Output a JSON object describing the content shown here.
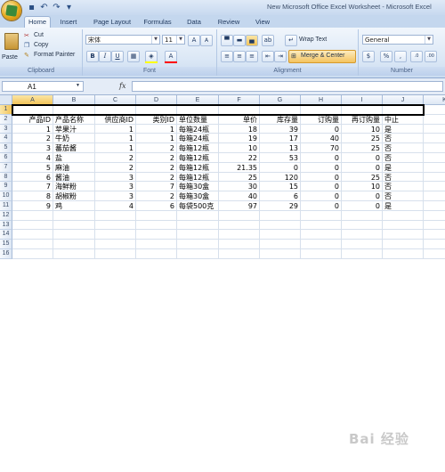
{
  "window": {
    "title": "New Microsoft Office Excel Worksheet - Microsoft Excel"
  },
  "tabs": [
    "Home",
    "Insert",
    "Page Layout",
    "Formulas",
    "Data",
    "Review",
    "View"
  ],
  "ribbon": {
    "clipboard": {
      "paste": "Paste",
      "cut": "Cut",
      "copy": "Copy",
      "format_painter": "Format Painter",
      "label": "Clipboard"
    },
    "font": {
      "name": "宋体",
      "size": "11",
      "bold": "B",
      "italic": "I",
      "underline": "U",
      "label": "Font",
      "font_color": "#ff0000",
      "fill_color": "#ffff00"
    },
    "alignment": {
      "wrap": "Wrap Text",
      "merge": "Merge & Center",
      "label": "Alignment"
    },
    "number": {
      "format": "General",
      "currency": "$",
      "percent": "%",
      "comma": ",",
      "label": "Number"
    }
  },
  "formula_bar": {
    "name_box": "A1",
    "fx": "fx",
    "value": ""
  },
  "columns": [
    "A",
    "B",
    "C",
    "D",
    "E",
    "F",
    "G",
    "H",
    "I",
    "J",
    "K"
  ],
  "row_numbers": [
    "1",
    "2",
    "3",
    "4",
    "5",
    "6",
    "7",
    "8",
    "9",
    "10",
    "11",
    "12",
    "13",
    "14",
    "15",
    "16"
  ],
  "headers": [
    "产品ID",
    "产品名称",
    "供应商ID",
    "类别ID",
    "单位数量",
    "单价",
    "库存量",
    "订购量",
    "再订购量",
    "中止"
  ],
  "rows": [
    [
      "1",
      "苹果汁",
      "1",
      "1",
      "每箱24瓶",
      "18",
      "39",
      "0",
      "10",
      "是"
    ],
    [
      "2",
      "牛奶",
      "1",
      "1",
      "每箱24瓶",
      "19",
      "17",
      "40",
      "25",
      "否"
    ],
    [
      "3",
      "蕃茄酱",
      "1",
      "2",
      "每箱12瓶",
      "10",
      "13",
      "70",
      "25",
      "否"
    ],
    [
      "4",
      "盐",
      "2",
      "2",
      "每箱12瓶",
      "22",
      "53",
      "0",
      "0",
      "否"
    ],
    [
      "5",
      "麻油",
      "2",
      "2",
      "每箱12瓶",
      "21.35",
      "0",
      "0",
      "0",
      "是"
    ],
    [
      "6",
      "酱油",
      "3",
      "2",
      "每箱12瓶",
      "25",
      "120",
      "0",
      "25",
      "否"
    ],
    [
      "7",
      "海鲜粉",
      "3",
      "7",
      "每箱30盒",
      "30",
      "15",
      "0",
      "10",
      "否"
    ],
    [
      "8",
      "胡椒粉",
      "3",
      "2",
      "每箱30盒",
      "40",
      "6",
      "0",
      "0",
      "否"
    ],
    [
      "9",
      "鸡",
      "4",
      "6",
      "每袋500克",
      "97",
      "29",
      "0",
      "0",
      "是"
    ]
  ],
  "watermark": "Bai 经验"
}
